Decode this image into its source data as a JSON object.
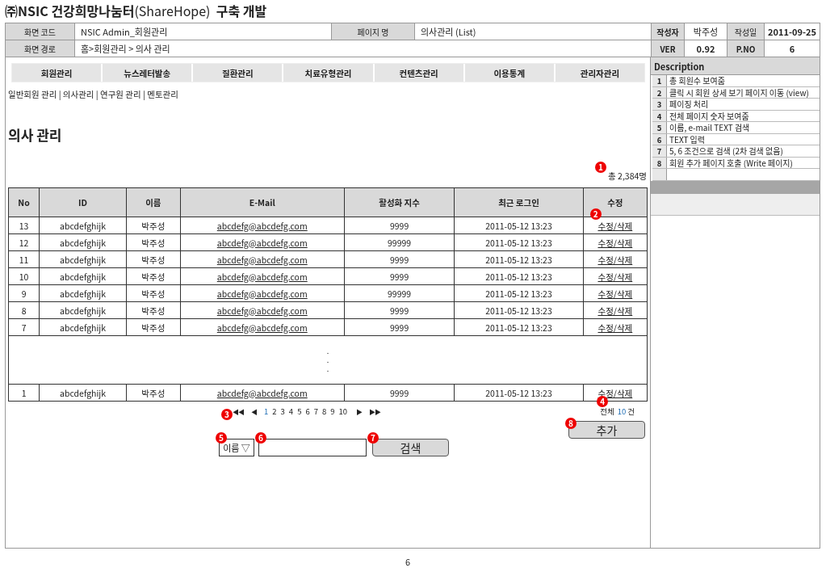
{
  "title": "**㈜NSIC 건강희망나눔터**(ShareHope)  **구축 개발**",
  "header": {
    "screen_code_label": "화면 코드",
    "screen_code": "NSIC Admin_회원관리",
    "page_name_label": "페이지 명",
    "page_name": "의사관리 (List)",
    "author_label": "작성자",
    "author": "박주성",
    "date_label": "작성일",
    "date": "2011-09-25",
    "path_label": "화면 경로",
    "path": "홈>회원관리 > 의사 관리",
    "ver_label": "VER",
    "ver": "0.92",
    "pno_label": "P.NO",
    "pno": "6"
  },
  "nav": {
    "menu": [
      {
        "label": "회원관리"
      },
      {
        "label": "뉴스레터발송"
      },
      {
        "label": "질환관리"
      },
      {
        "label": "치료유형관리"
      },
      {
        "label": "컨텐츠관리"
      },
      {
        "label": "이용통계"
      },
      {
        "label": "관리자관리"
      }
    ],
    "submenu": "일반회원 관리 | 의사관리 | 연구원 관리 | 멘토관리"
  },
  "heading": "의사 관리",
  "total": {
    "marker": "1",
    "text": "총 2,384명"
  },
  "table": {
    "columns": [
      "No",
      "ID",
      "이름",
      "E-Mail",
      "활성화 지수",
      "최근 로그인",
      "수정"
    ],
    "edit_marker": "2",
    "rows": [
      {
        "kind": "row",
        "no": "13",
        "id": "abcdefghijk",
        "name": "박주성",
        "email": "abcdefg@abcdefg.com",
        "activity": "9999",
        "login": "2011-05-12 13:23",
        "edit": "수정/삭제"
      },
      {
        "kind": "row",
        "no": "12",
        "id": "abcdefghijk",
        "name": "박주성",
        "email": "abcdefg@abcdefg.com",
        "activity": "99999",
        "login": "2011-05-12 13:23",
        "edit": "수정/삭제"
      },
      {
        "kind": "row",
        "no": "11",
        "id": "abcdefghijk",
        "name": "박주성",
        "email": "abcdefg@abcdefg.com",
        "activity": "9999",
        "login": "2011-05-12 13:23",
        "edit": "수정/삭제"
      },
      {
        "kind": "row",
        "no": "10",
        "id": "abcdefghijk",
        "name": "박주성",
        "email": "abcdefg@abcdefg.com",
        "activity": "9999",
        "login": "2011-05-12 13:23",
        "edit": "수정/삭제"
      },
      {
        "kind": "row",
        "no": "9",
        "id": "abcdefghijk",
        "name": "박주성",
        "email": "abcdefg@abcdefg.com",
        "activity": "99999",
        "login": "2011-05-12 13:23",
        "edit": "수정/삭제"
      },
      {
        "kind": "row",
        "no": "8",
        "id": "abcdefghijk",
        "name": "박주성",
        "email": "abcdefg@abcdefg.com",
        "activity": "9999",
        "login": "2011-05-12 13:23",
        "edit": "수정/삭제"
      },
      {
        "kind": "row",
        "no": "7",
        "id": "abcdefghijk",
        "name": "박주성",
        "email": "abcdefg@abcdefg.com",
        "activity": "9999",
        "login": "2011-05-12 13:23",
        "edit": "수정/삭제"
      },
      {
        "kind": "gap",
        "dots": [
          ".",
          ".",
          "."
        ]
      },
      {
        "kind": "row",
        "no": "1",
        "id": "abcdefghijk",
        "name": "박주성",
        "email": "abcdefg@abcdefg.com",
        "activity": "9999",
        "login": "2011-05-12 13:23",
        "edit": "수정/삭제"
      }
    ]
  },
  "pagination": {
    "marker": "3",
    "first": "◀◀",
    "prev": "◀",
    "pages": [
      {
        "label": "1",
        "selected": true
      },
      {
        "label": "2",
        "selected": false
      },
      {
        "label": "3",
        "selected": false
      },
      {
        "label": "4",
        "selected": false
      },
      {
        "label": "5",
        "selected": false
      },
      {
        "label": "6",
        "selected": false
      },
      {
        "label": "7",
        "selected": false
      },
      {
        "label": "8",
        "selected": false
      },
      {
        "label": "9",
        "selected": false
      },
      {
        "label": "10",
        "selected": false
      }
    ],
    "next": "▶",
    "last": "▶▶"
  },
  "count": {
    "marker": "4",
    "prefix": "전체",
    "number": "10",
    "suffix": "건"
  },
  "add": {
    "marker": "8",
    "label": "추가"
  },
  "search": {
    "select_marker": "5",
    "select": "이름",
    "caret": "▽",
    "input_marker": "6",
    "button_marker": "7",
    "button": "검색"
  },
  "description": {
    "title": "Description",
    "items": [
      {
        "number": "1",
        "text": "총 회원수 보여줌"
      },
      {
        "number": "2",
        "text": "클릭 시 회원 상세 보기 페이지 이동 (view)"
      },
      {
        "number": "3",
        "text": "페이징 처리"
      },
      {
        "number": "4",
        "text": "전체 페이지 숫자 보여줌"
      },
      {
        "number": "5",
        "text": "이름, e-mail TEXT 검색"
      },
      {
        "number": "6",
        "text": "TEXT 입력"
      },
      {
        "number": "7",
        "text": "5, 6 조건으로 검색 (2차 검색 없음)"
      },
      {
        "number": "8",
        "text": "회원 추가 페이지 호출 (Write 페이지)"
      }
    ]
  },
  "page_number": "6"
}
